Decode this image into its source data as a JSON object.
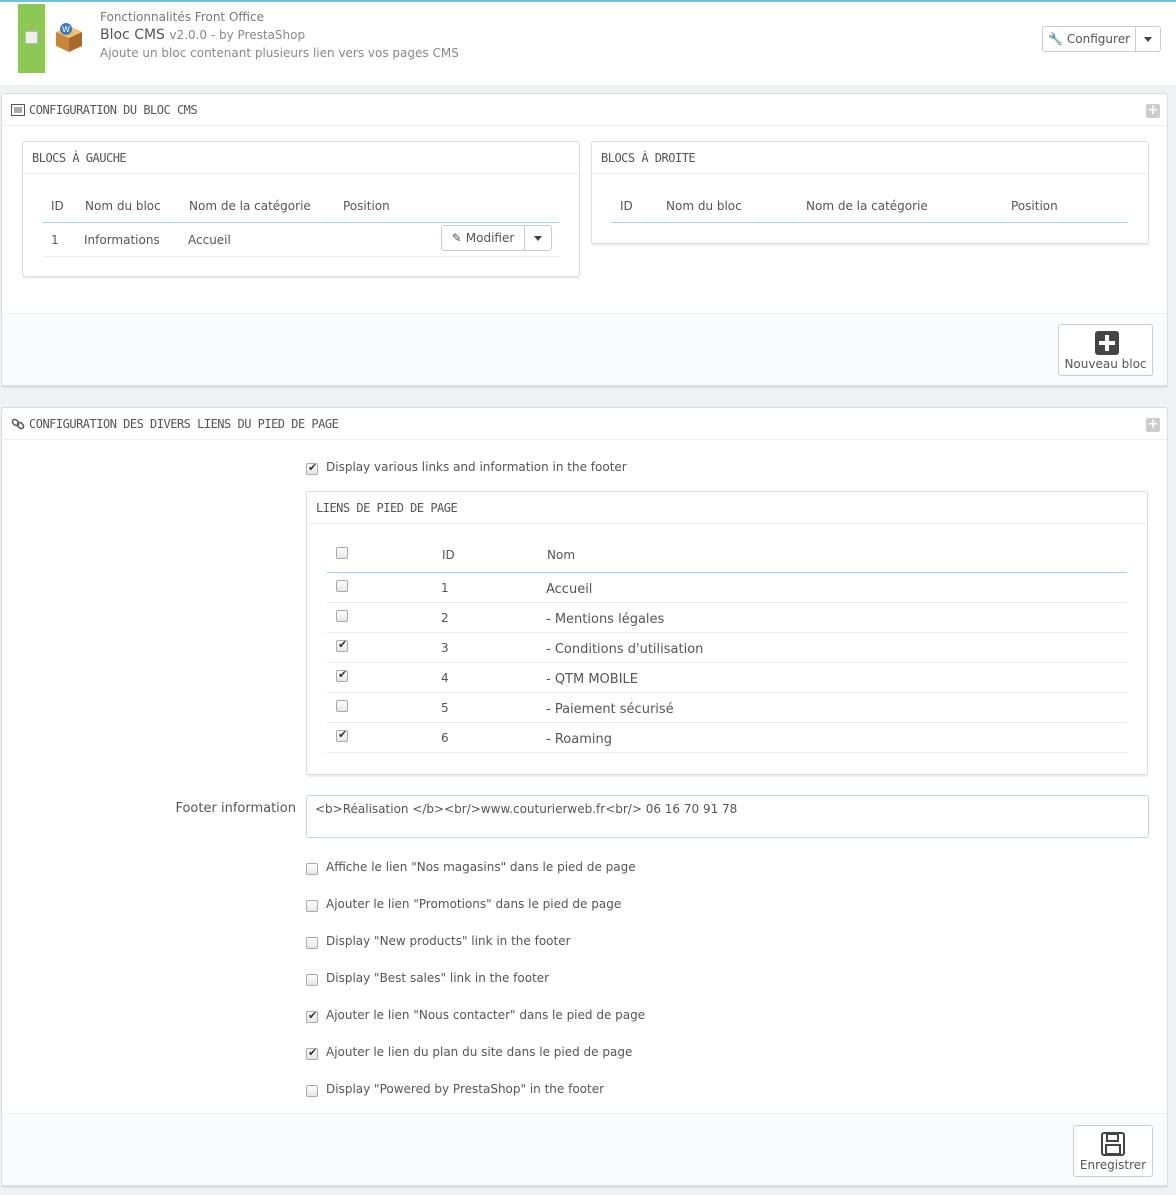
{
  "module": {
    "category": "Fonctionnalités Front Office",
    "name": "Bloc CMS",
    "version": "v2.0.0 - by PrestaShop",
    "description": "Ajoute un bloc contenant plusieurs lien vers vos pages CMS",
    "configure_label": "Configurer"
  },
  "cms_panel": {
    "title": "CONFIGURATION DU BLOC CMS",
    "left": {
      "title": "BLOCS À GAUCHE",
      "headers": [
        "ID",
        "Nom du bloc",
        "Nom de la catégorie",
        "Position"
      ],
      "rows": [
        {
          "id": "1",
          "name": "Informations",
          "category": "Accueil",
          "action": "Modifier"
        }
      ]
    },
    "right": {
      "title": "BLOCS À DROITE",
      "headers": [
        "ID",
        "Nom du bloc",
        "Nom de la catégorie",
        "Position"
      ]
    },
    "new_block_label": "Nouveau bloc"
  },
  "footer_panel": {
    "title": "CONFIGURATION DES DIVERS LIENS DU PIED DE PAGE",
    "display_links_label": "Display various links and information in the footer",
    "display_links_checked": true,
    "links_table": {
      "title": "LIENS DE PIED DE PAGE",
      "headers": [
        "ID",
        "Nom"
      ],
      "rows": [
        {
          "id": "1",
          "name": "Accueil",
          "checked": false
        },
        {
          "id": "2",
          "name": "- Mentions légales",
          "checked": false
        },
        {
          "id": "3",
          "name": "- Conditions d'utilisation",
          "checked": true
        },
        {
          "id": "4",
          "name": "- QTM MOBILE",
          "checked": true
        },
        {
          "id": "5",
          "name": "- Paiement sécurisé",
          "checked": false
        },
        {
          "id": "6",
          "name": "- Roaming",
          "checked": true
        }
      ]
    },
    "footer_info_label": "Footer information",
    "footer_info_value": "<b>Réalisation </b><br/>www.couturierweb.fr<br/> 06 16 70 91 78",
    "options": [
      {
        "label": "Affiche le lien \"Nos magasins\" dans le pied de page",
        "checked": false
      },
      {
        "label": "Ajouter le lien \"Promotions\" dans le pied de page",
        "checked": false
      },
      {
        "label": "Display \"New products\" link in the footer",
        "checked": false
      },
      {
        "label": "Display \"Best sales\" link in the footer",
        "checked": false
      },
      {
        "label": "Ajouter le lien \"Nous contacter\" dans le pied de page",
        "checked": true
      },
      {
        "label": "Ajouter le lien du plan du site dans le pied de page",
        "checked": true
      },
      {
        "label": "Display \"Powered by PrestaShop\" in the footer",
        "checked": false
      }
    ],
    "save_label": "Enregistrer"
  }
}
